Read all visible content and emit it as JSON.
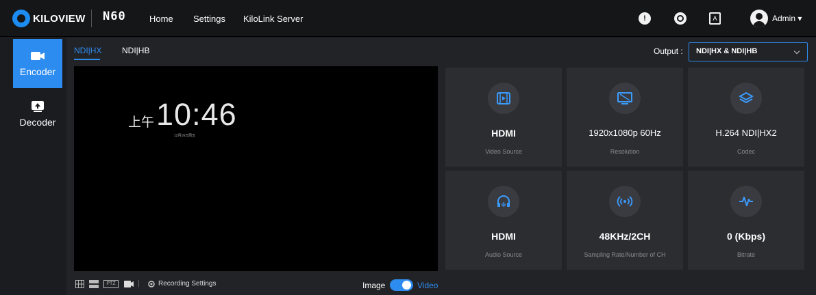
{
  "header": {
    "logo_text": "KILOVIEW",
    "model": "N60",
    "nav": [
      "Home",
      "Settings",
      "KiloLink Server"
    ],
    "user": "Admin",
    "icons": [
      "alert-icon",
      "help-icon",
      "language-icon",
      "user-icon"
    ]
  },
  "sidebar": {
    "items": [
      {
        "label": "Encoder",
        "icon": "camera-icon",
        "active": true
      },
      {
        "label": "Decoder",
        "icon": "monitor-upload-icon",
        "active": false
      }
    ]
  },
  "tabs": [
    {
      "label": "NDI|HX",
      "active": true
    },
    {
      "label": "NDI|HB",
      "active": false
    }
  ],
  "output": {
    "label": "Output :",
    "value": "NDI|HX & NDI|HB"
  },
  "preview": {
    "ampm": "上午",
    "time": "10:46",
    "date": "12月16日周五"
  },
  "cards": [
    {
      "value": "HDMI",
      "label": "Video Source",
      "icon": "video-file-icon"
    },
    {
      "value": "1920x1080p 60Hz",
      "label": "Resolution",
      "icon": "screen-icon"
    },
    {
      "value": "H.264 NDI|HX2",
      "label": "Codec",
      "icon": "layers-icon"
    },
    {
      "value": "HDMI",
      "label": "Audio Source",
      "icon": "headphones-icon"
    },
    {
      "value": "48KHz/2CH",
      "label": "Sampling Rate/Number of CH",
      "icon": "broadcast-icon"
    },
    {
      "value": "0 (Kbps)",
      "label": "Bitrate",
      "icon": "pulse-icon"
    }
  ],
  "toolbar": {
    "ptz": "PTZ",
    "recording": "Recording Settings",
    "image_label": "Image",
    "video_label": "Video",
    "accent": "#2d8cf0"
  }
}
